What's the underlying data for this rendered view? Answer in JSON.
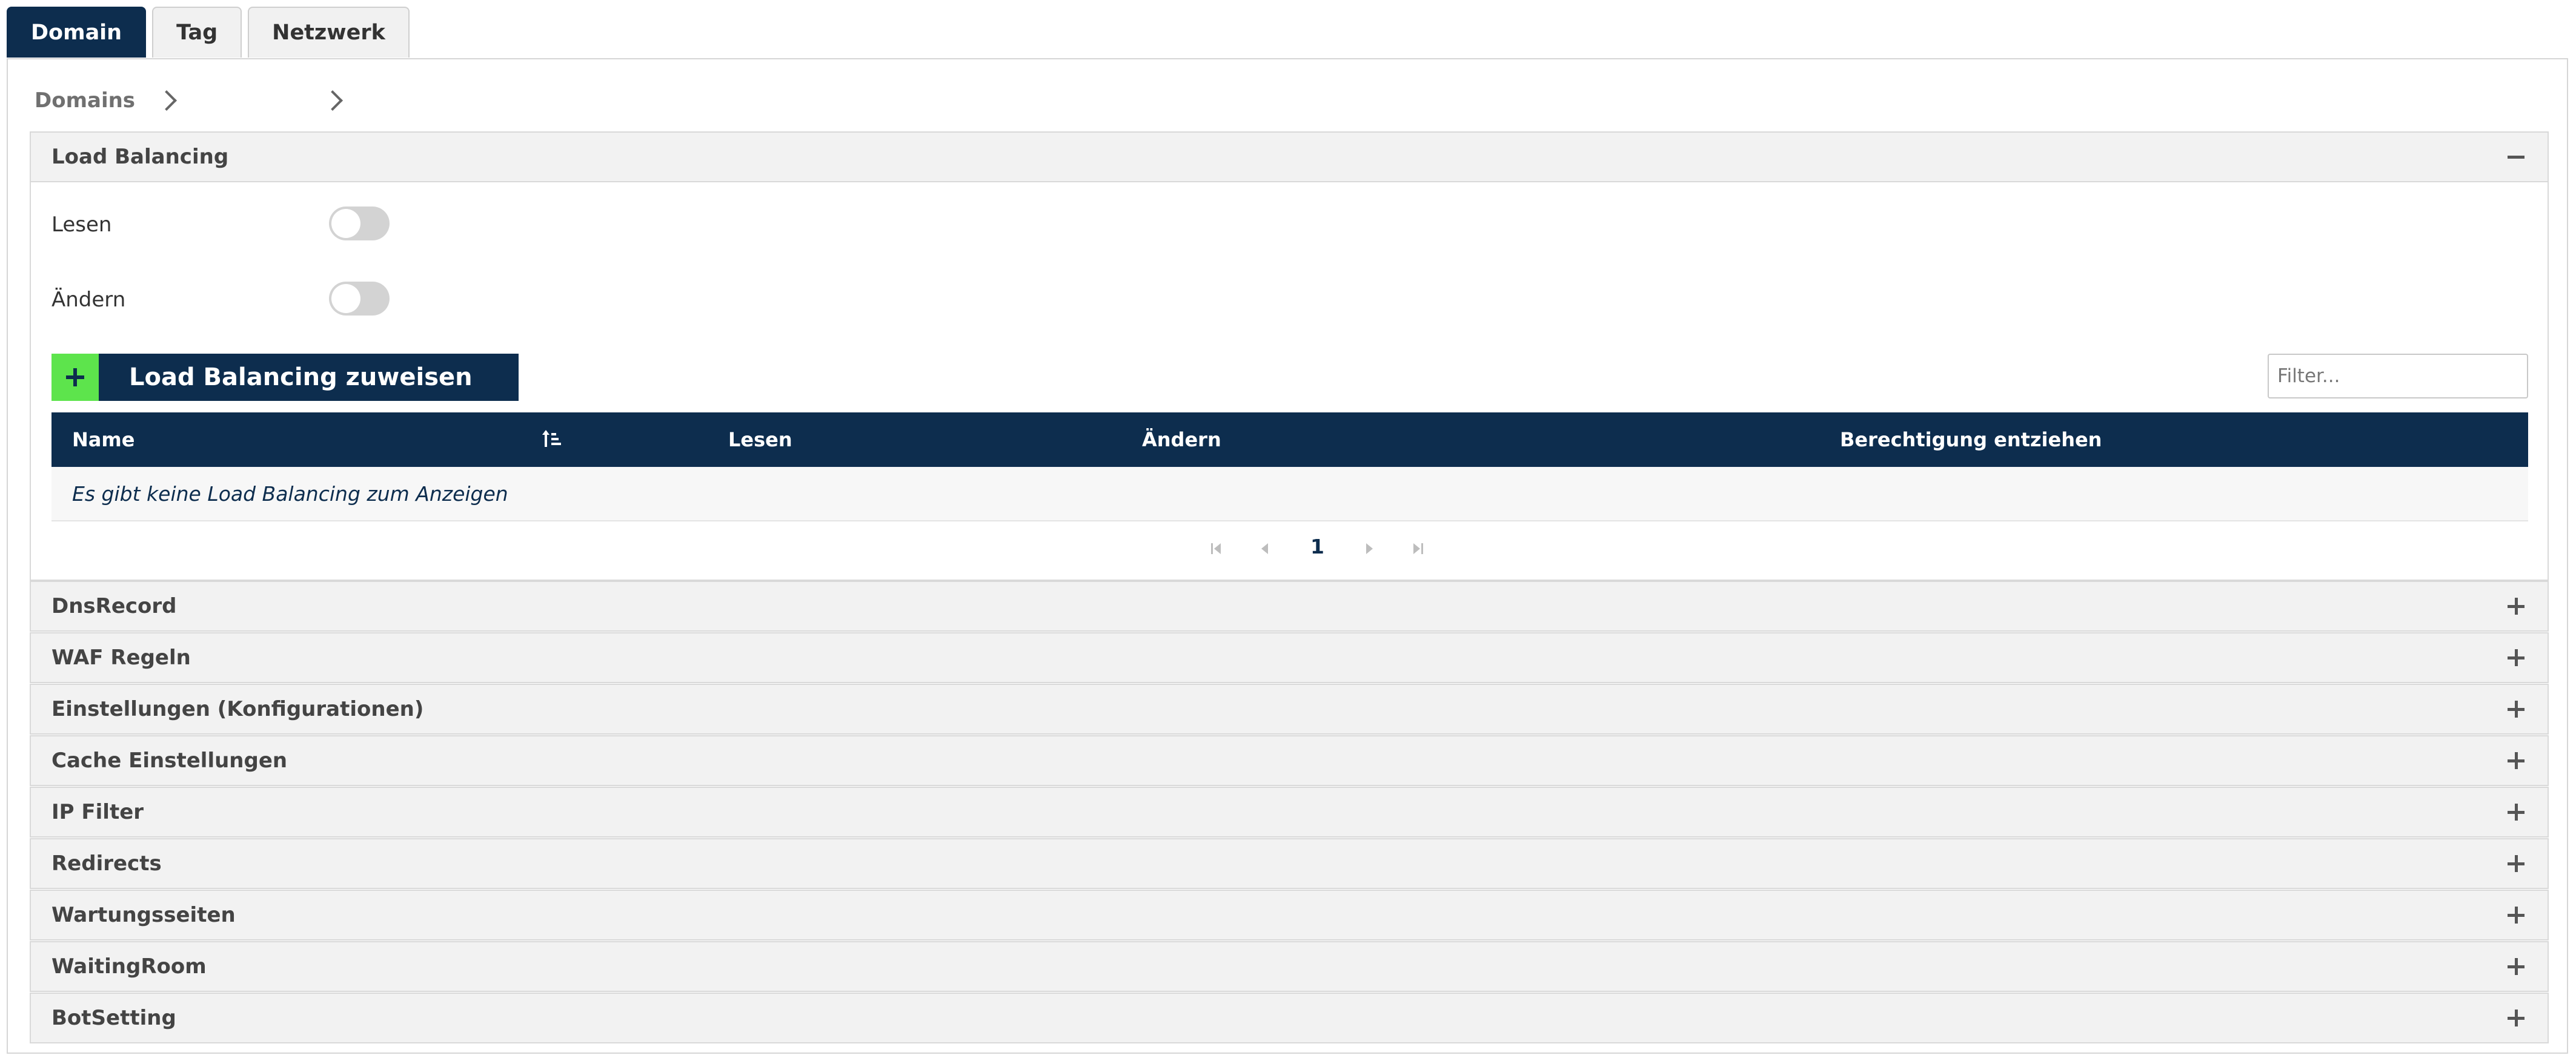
{
  "tabs": [
    {
      "label": "Domain",
      "active": true
    },
    {
      "label": "Tag",
      "active": false
    },
    {
      "label": "Netzwerk",
      "active": false
    }
  ],
  "breadcrumb": {
    "root": "Domains",
    "current": ""
  },
  "load_balancing": {
    "title": "Load Balancing",
    "expanded": true,
    "permissions": [
      {
        "label": "Lesen",
        "enabled": false
      },
      {
        "label": "Ändern",
        "enabled": false
      }
    ],
    "assign_button": "Load Balancing zuweisen",
    "filter_placeholder": "Filter...",
    "table": {
      "columns": [
        "Name",
        "Lesen",
        "Ändern",
        "Berechtigung entziehen"
      ],
      "empty_message": "Es gibt keine Load Balancing zum Anzeigen"
    },
    "pager": {
      "current_page": "1"
    }
  },
  "sections": [
    "DnsRecord",
    "WAF Regeln",
    "Einstellungen (Konfigurationen)",
    "Cache Einstellungen",
    "IP Filter",
    "Redirects",
    "Wartungsseiten",
    "WaitingRoom",
    "BotSetting"
  ],
  "colors": {
    "navy": "#0d2d4e",
    "green": "#5de44c",
    "panel_header": "#f2f2f2",
    "toggle_off": "#d3d3d3"
  }
}
